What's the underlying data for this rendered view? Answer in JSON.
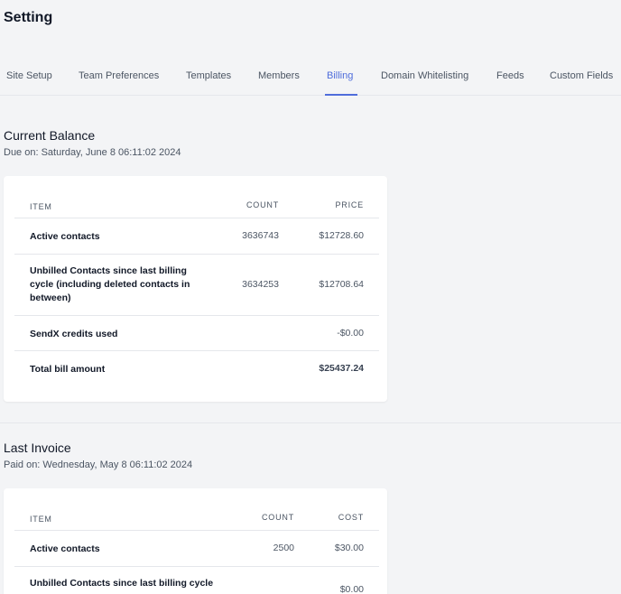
{
  "page": {
    "title": "Setting"
  },
  "tabs": [
    {
      "label": "Site Setup"
    },
    {
      "label": "Team Preferences"
    },
    {
      "label": "Templates"
    },
    {
      "label": "Members"
    },
    {
      "label": "Billing",
      "active": true
    },
    {
      "label": "Domain Whitelisting"
    },
    {
      "label": "Feeds"
    },
    {
      "label": "Custom Fields"
    }
  ],
  "current_balance": {
    "title": "Current Balance",
    "subtitle": "Due on: Saturday, June 8 06:11:02 2024",
    "headers": {
      "item": "ITEM",
      "count": "COUNT",
      "price": "PRICE"
    },
    "rows": [
      {
        "item": "Active contacts",
        "count": "3636743",
        "price": "$12728.60"
      },
      {
        "item": "Unbilled Contacts since last billing cycle (including deleted contacts in between)",
        "count": "3634253",
        "price": "$12708.64"
      },
      {
        "item": "SendX credits used",
        "count": "",
        "price": "-$0.00"
      },
      {
        "item": "Total bill amount",
        "count": "",
        "price": "$25437.24"
      }
    ]
  },
  "last_invoice": {
    "title": "Last Invoice",
    "subtitle": "Paid on: Wednesday, May 8 06:11:02 2024",
    "headers": {
      "item": "ITEM",
      "count": "COUNT",
      "cost": "COST"
    },
    "rows": [
      {
        "item": "Active contacts",
        "count": "2500",
        "cost": "$30.00"
      },
      {
        "item": "Unbilled Contacts since last billing cycle",
        "count": "",
        "cost": "$0.00"
      }
    ]
  },
  "colors": {
    "accent": "#4f6ddb",
    "background": "#f3f4f6",
    "card": "#ffffff"
  }
}
